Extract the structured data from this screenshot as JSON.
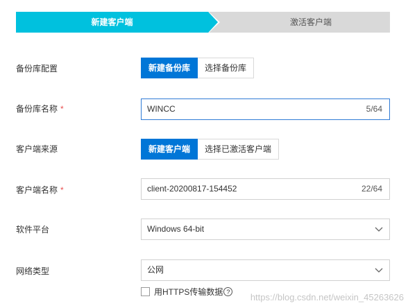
{
  "steps": [
    {
      "label": "新建客户端",
      "active": true
    },
    {
      "label": "激活客户端",
      "active": false
    }
  ],
  "form": {
    "repo_config": {
      "label": "备份库配置",
      "options": [
        "新建备份库",
        "选择备份库"
      ],
      "selected": "新建备份库"
    },
    "repo_name": {
      "label": "备份库名称",
      "required_mark": "*",
      "value": "WINCC",
      "counter": "5/64"
    },
    "client_source": {
      "label": "客户端来源",
      "options": [
        "新建客户端",
        "选择已激活客户端"
      ],
      "selected": "新建客户端"
    },
    "client_name": {
      "label": "客户端名称",
      "required_mark": "*",
      "value": "client-20200817-154452",
      "counter": "22/64"
    },
    "platform": {
      "label": "软件平台",
      "value": "Windows 64-bit"
    },
    "network": {
      "label": "网络类型",
      "value": "公网"
    },
    "https_option": {
      "label": "用HTTPS传输数据",
      "help": "?",
      "checked": false
    }
  },
  "watermark": "https://blog.csdn.net/weixin_45263626",
  "colors": {
    "step_active": "#00c1de",
    "primary": "#0076d7",
    "required": "#e84e4e"
  }
}
